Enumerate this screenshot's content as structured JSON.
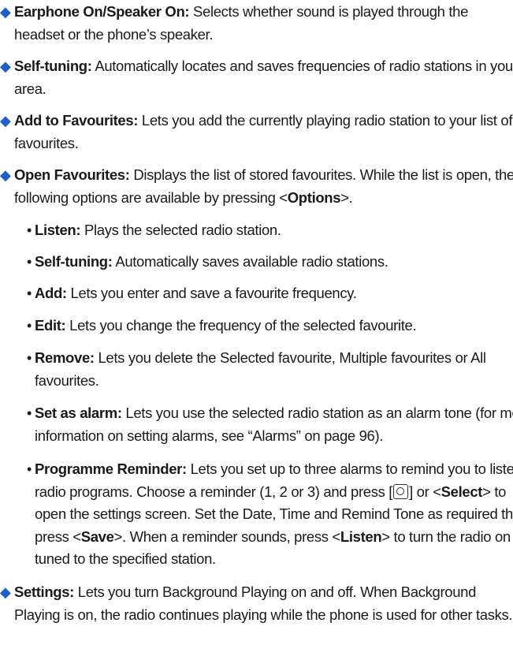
{
  "bullet_glyph": "◆",
  "sub_bullet_glyph": "•",
  "bullet_color": "#1f5fbf",
  "items": [
    {
      "term": "Earphone On/Speaker On:",
      "text": "Selects whether sound is played through the headset or the phone’s speaker."
    },
    {
      "term": "Self-tuning:",
      "text": "Automatically locates and saves frequencies of radio stations in your area."
    },
    {
      "term": "Add to Favourites:",
      "text": "Lets you add the currently playing radio station to your list of favourites."
    },
    {
      "term": "Open Favourites:",
      "text_a": "Displays the list of stored favourites. While the list is open, the following options are available by pressing <",
      "options_key": "Options",
      "text_b": ">."
    },
    {
      "term": "Settings:",
      "text": "Lets you turn Background Playing on and off. When Background Playing is on, the radio continues playing while the phone is used for other tasks."
    }
  ],
  "sub_items": [
    {
      "term": "Listen:",
      "text": "Plays the selected radio station."
    },
    {
      "term": "Self-tuning:",
      "text": "Automatically saves available radio stations."
    },
    {
      "term": "Add:",
      "text": "Lets you enter and save a favourite frequency."
    },
    {
      "term": "Edit:",
      "text": "Lets you change the frequency of the selected favourite."
    },
    {
      "term": "Remove:",
      "text": "Lets you delete the Selected favourite, Multiple favourites or All favourites."
    },
    {
      "term": "Set as alarm:",
      "text": "Lets you use the selected radio station as an alarm tone (for more information on setting alarms, see “Alarms” on page 96)."
    }
  ],
  "reminder": {
    "term": "Programme Reminder:",
    "t1": "Lets you set up to three alarms to remind you to listen to radio programs. Choose a reminder (1, 2 or 3) and press [",
    "key_icon": "ok-key-icon",
    "t2": "] or <",
    "select": "Select",
    "t3": "> to open the settings screen. Set the Date, Time and Remind Tone as required then press <",
    "save": "Save",
    "t4": ">. When a reminder sounds, press <",
    "listen": "Listen",
    "t5": "> to turn the radio on tuned to the specified station."
  }
}
